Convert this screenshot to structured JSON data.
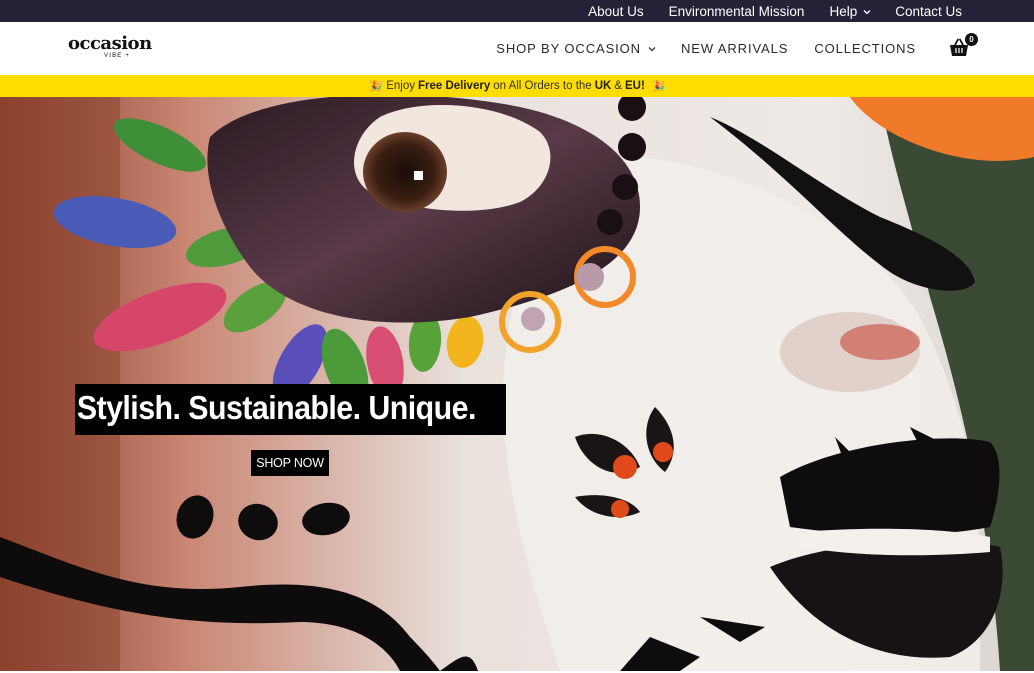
{
  "topbar": {
    "links": [
      {
        "label": "About Us"
      },
      {
        "label": "Environmental Mission"
      },
      {
        "label": "Help",
        "has_dropdown": true
      },
      {
        "label": "Contact Us"
      }
    ]
  },
  "header": {
    "logo": {
      "main": "occasion",
      "sub": "VIBE +"
    },
    "nav": [
      {
        "label": "SHOP BY OCCASION",
        "has_dropdown": true
      },
      {
        "label": "NEW ARRIVALS"
      },
      {
        "label": "COLLECTIONS"
      }
    ],
    "cart": {
      "icon": "shopping-basket-icon",
      "count": "0"
    }
  },
  "announcement": {
    "icon": "party-popper-icon",
    "prefix": "Enjoy",
    "bold1": "Free Delivery",
    "middle": "on All Orders to the",
    "bold2": "UK",
    "amp": "&",
    "bold3": "EU!"
  },
  "hero": {
    "headline": "Stylish. Sustainable. Unique.",
    "cta": "SHOP NOW"
  },
  "colors": {
    "topbar_bg": "#252238",
    "announce_bg": "#ffdd00",
    "text_dark": "#222222"
  }
}
